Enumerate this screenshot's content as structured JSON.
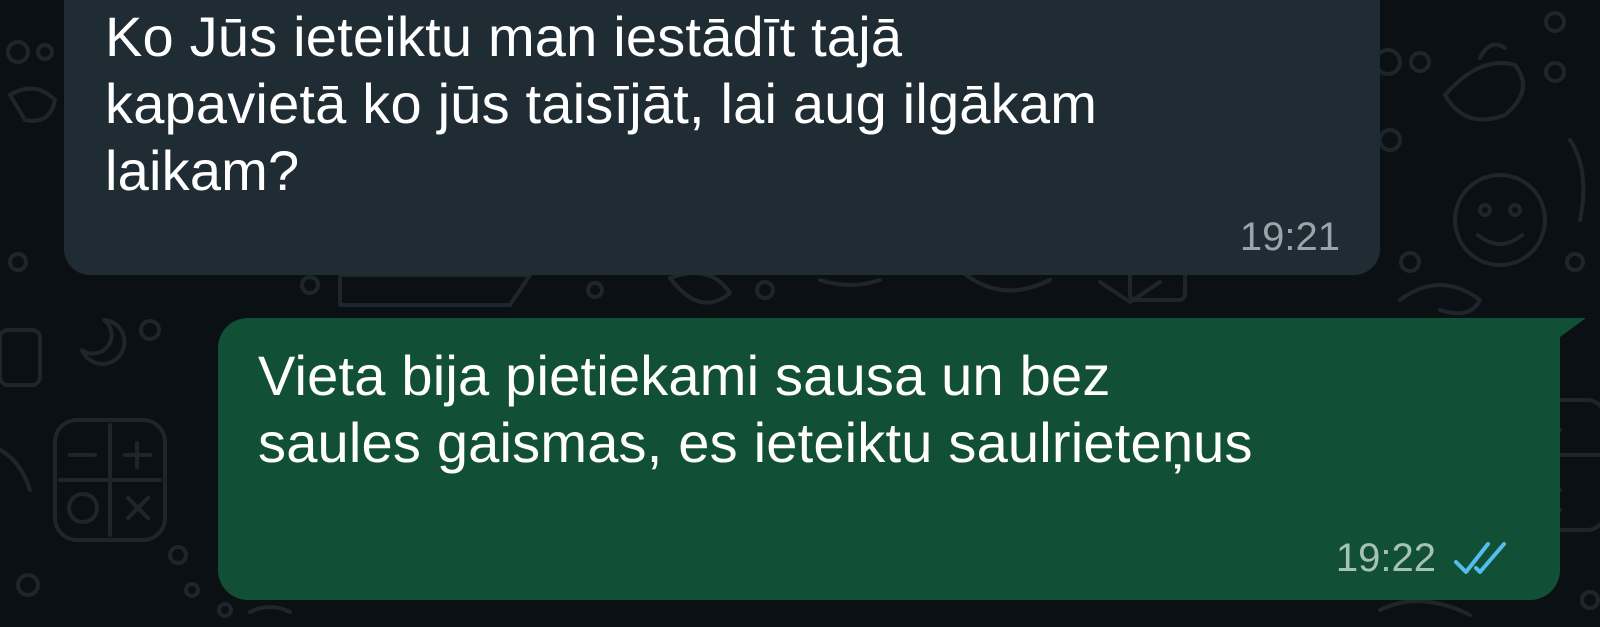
{
  "chat": {
    "messages": [
      {
        "direction": "incoming",
        "text": "Ko Jūs ieteiktu man iestādīt tajā\nkapavietā ko jūs taisījāt, lai aug ilgākam\nlaikam?",
        "time": "19:21"
      },
      {
        "direction": "outgoing",
        "text": "Vieta bija pietiekami sausa un bez\nsaules gaismas, es ieteiktu saulrieteņus",
        "time": "19:22",
        "status_icon": "double-check-read-icon"
      }
    ]
  },
  "colors": {
    "background": "#0b1014",
    "incoming_bubble": "#202c33",
    "outgoing_bubble": "#115036",
    "read_ticks": "#53bdeb",
    "text": "#ffffff"
  }
}
